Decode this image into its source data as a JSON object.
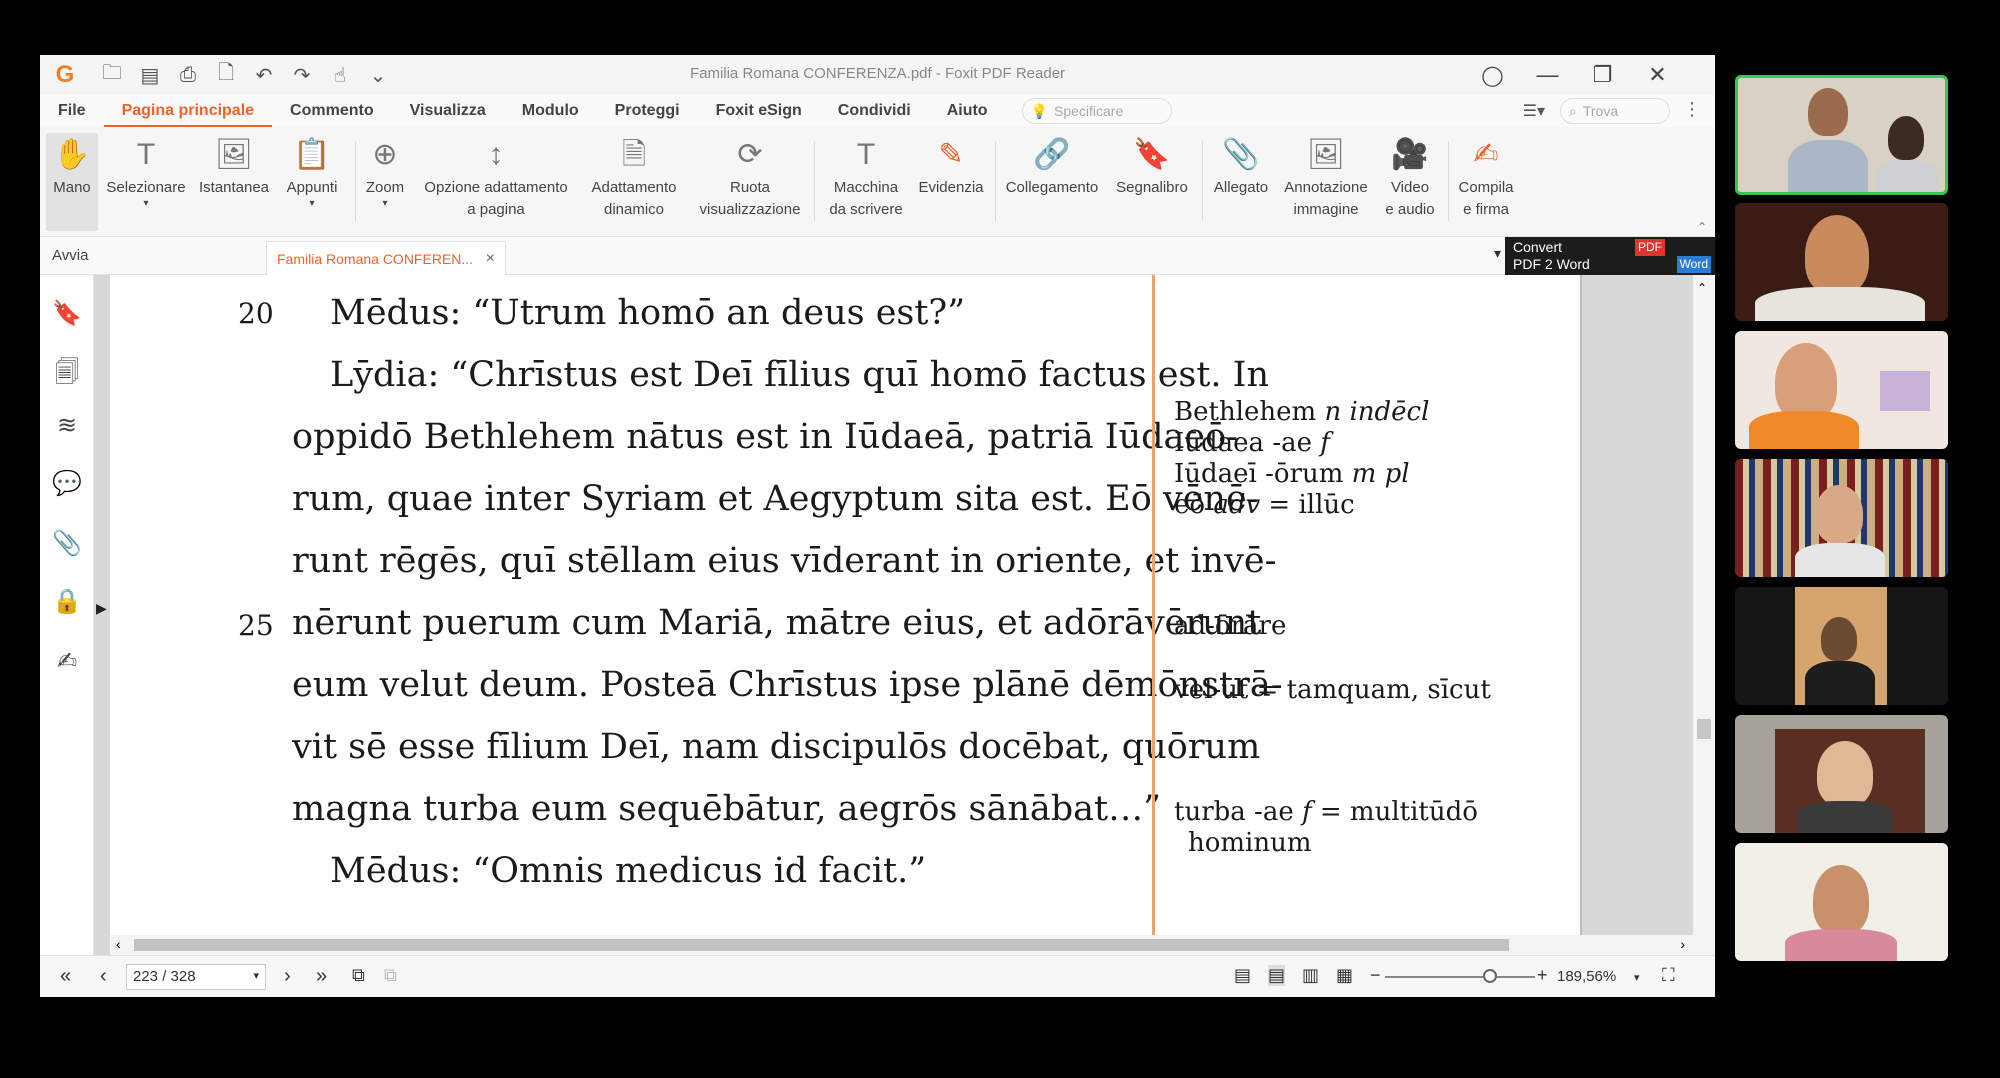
{
  "app": {
    "window_title": "Familia Romana CONFERENZA.pdf - Foxit PDF Reader"
  },
  "menu": {
    "tabs": [
      "File",
      "Pagina principale",
      "Commento",
      "Visualizza",
      "Modulo",
      "Proteggi",
      "Foxit eSign",
      "Condividi",
      "Aiuto"
    ],
    "tell_me_placeholder": "Specificare",
    "search_placeholder": "Trova"
  },
  "ribbon": {
    "mano": "Mano",
    "selezionare": "Selezionare",
    "istantanea": "Istantanea",
    "appunti": "Appunti",
    "zoom": "Zoom",
    "opzione_1": "Opzione adattamento",
    "opzione_2": "a pagina",
    "adattamento_1": "Adattamento",
    "adattamento_2": "dinamico",
    "ruota_1": "Ruota",
    "ruota_2": "visualizzazione",
    "macchina_1": "Macchina",
    "macchina_2": "da scrivere",
    "evidenzia": "Evidenzia",
    "collegamento": "Collegamento",
    "segnalibro": "Segnalibro",
    "allegato": "Allegato",
    "annotazione_1": "Annotazione",
    "annotazione_2": "immagine",
    "video_1": "Video",
    "video_2": "e audio",
    "compila_1": "Compila",
    "compila_2": "e firma"
  },
  "ad": {
    "line1": "Convert",
    "line2": "PDF 2 Word",
    "pdf_badge": "PDF",
    "word_badge": "Word"
  },
  "tabs": {
    "start": "Avvia",
    "document": "Familia Romana CONFEREN..."
  },
  "document": {
    "line_numbers": [
      "20",
      "25"
    ],
    "lines": [
      "Mēdus: “Utrum homō an deus est?”",
      "Lȳdia: “Chrīstus est Deī fīlius quī homō factus est. In",
      "oppidō Bethlehem nātus est in Iūdaeā, patriā Iūdaeō-",
      "rum, quae inter Syriam et Aegyptum sita est. Eō vēnē-",
      "runt rēgēs, quī stēllam eius vīderant in oriente, et invē-",
      "nērunt puerum cum Mariā, mātre eius, et adōrāvērunt",
      "eum velut deum. Posteā Chrīstus ipse plānē dēmōnstrā-",
      "vit sē esse fīlium Deī, nam discipulōs docēbat, quōrum",
      "magna turba eum sequēbātur, aegrōs sānābat…”",
      "Mēdus: “Omnis medicus id facit.”"
    ],
    "notes": {
      "bethlehem": "Bethlehem",
      "bethlehem_gram": "n indēcl",
      "iudaea": "Iūdaea -ae",
      "iudaea_gram": "f",
      "iudaei": "Iūdaeī -ōrum",
      "iudaei_gram": "m pl",
      "eo": "eō",
      "eo_gram": "adv",
      "eo_def": "= illūc",
      "adorare": "ad-ōrāre",
      "velut": "vel-ut = tamquam, sīcut",
      "turba": "turba -ae",
      "turba_gram": "f",
      "turba_def": "= multitūdō",
      "hominum": "hominum"
    }
  },
  "status": {
    "page": "223 / 328",
    "zoom": "189,56%"
  }
}
